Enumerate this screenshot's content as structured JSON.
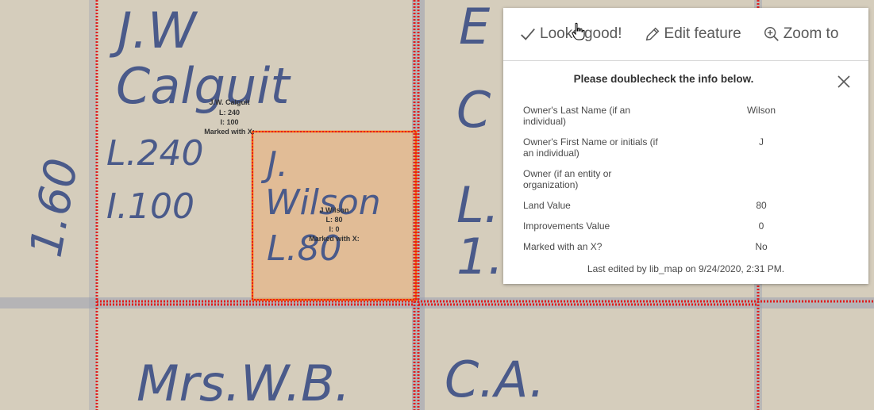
{
  "map": {
    "parcels": {
      "calguit_label": [
        "J.W. Calguit",
        "L: 240",
        "I: 100",
        "Marked with X:"
      ],
      "wilson_label": [
        "J Wilson",
        "L: 80",
        "I: 0",
        "Marked with X:"
      ]
    },
    "handwriting": {
      "jw": "J.W",
      "calguit": "Calguit",
      "l240": "L.240",
      "i100": "I.100",
      "j": "J.",
      "wilson": "Wilson",
      "l80": "L.80",
      "mrswb": "Mrs.W.B.",
      "ca": "C.A."
    }
  },
  "popup": {
    "toolbar": {
      "looks_good": "Looks good!",
      "edit_feature": "Edit feature",
      "zoom_to": "Zoom to"
    },
    "title": "Please doublecheck the info below.",
    "attributes": [
      {
        "key": "Owner's Last Name (if an individual)",
        "value": "Wilson"
      },
      {
        "key": "Owner's First Name or initials (if an individual)",
        "value": "J"
      },
      {
        "key": "Owner (if an entity or organization)",
        "value": ""
      },
      {
        "key": "Land Value",
        "value": "80"
      },
      {
        "key": "Improvements Value",
        "value": "0"
      },
      {
        "key": "Marked with an X?",
        "value": "No"
      }
    ],
    "footer": "Last edited by lib_map on 9/24/2020, 2:31 PM."
  },
  "colors": {
    "parcel_outline": "#e01e1e",
    "selected_fill": "#f0a868",
    "selected_outline": "#ff6a00",
    "ink": "#4a5a8a"
  },
  "icons": {
    "looks_good": "check-icon",
    "edit_feature": "pencil-icon",
    "zoom_to": "zoom-in-icon",
    "close": "close-icon",
    "cursor": "hand-pointer-icon"
  }
}
